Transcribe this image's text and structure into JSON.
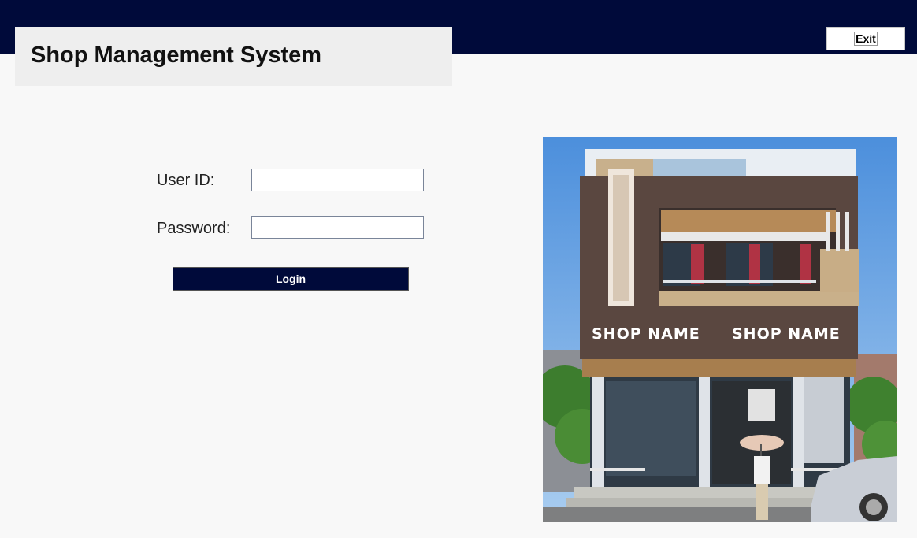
{
  "app": {
    "title": "Shop Management System"
  },
  "header": {
    "exit_label": "Exit"
  },
  "login_form": {
    "user_id_label": "User ID:",
    "user_id_value": "",
    "password_label": "Password:",
    "password_value": "",
    "login_label": "Login"
  },
  "shop_photo": {
    "sign_left": "SHOP NAME",
    "sign_right": "SHOP NAME",
    "description_icon": "storefront-photo"
  },
  "colors": {
    "navy": "#000a3a",
    "title_panel": "#eeeeee",
    "page_background": "#f8f8f8"
  }
}
